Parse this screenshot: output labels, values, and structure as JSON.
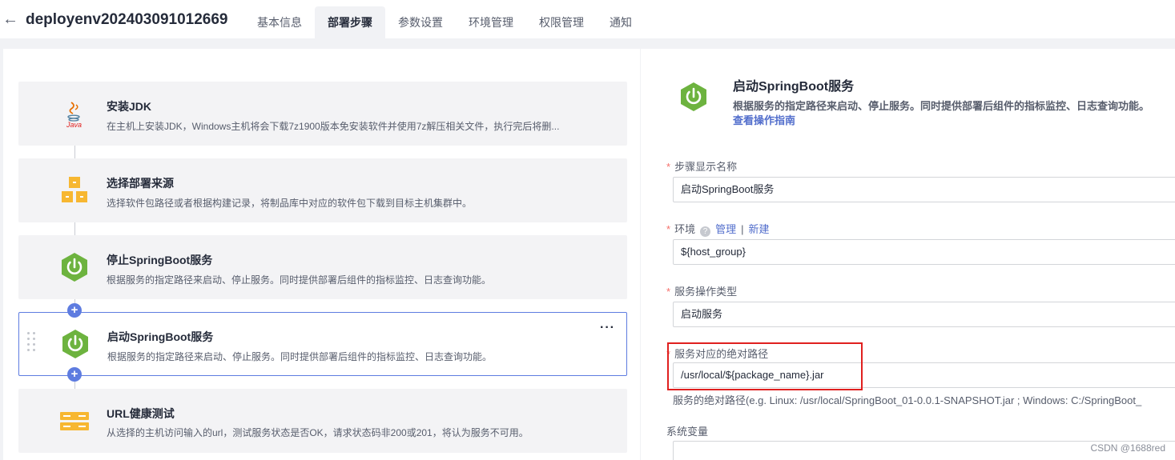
{
  "header": {
    "back_icon": "arrow-left-icon",
    "title": "deployenv202403091012669",
    "tabs": [
      {
        "label": "基本信息"
      },
      {
        "label": "部署步骤",
        "active": true
      },
      {
        "label": "参数设置"
      },
      {
        "label": "环境管理"
      },
      {
        "label": "权限管理"
      },
      {
        "label": "通知"
      }
    ]
  },
  "steps": [
    {
      "title": "安装JDK",
      "desc": "在主机上安装JDK，Windows主机将会下载7z1900版本免安装软件并使用7z解压相关文件，执行完后将删...",
      "icon": "java-icon"
    },
    {
      "title": "选择部署来源",
      "desc": "选择软件包路径或者根据构建记录，将制品库中对应的软件包下载到目标主机集群中。",
      "icon": "package-boxes-icon"
    },
    {
      "title": "停止SpringBoot服务",
      "desc": "根据服务的指定路径来启动、停止服务。同时提供部署后组件的指标监控、日志查询功能。",
      "icon": "springboot-power-icon"
    },
    {
      "title": "启动SpringBoot服务",
      "desc": "根据服务的指定路径来启动、停止服务。同时提供部署后组件的指标监控、日志查询功能。",
      "icon": "springboot-power-icon",
      "selected": true,
      "more": "···"
    },
    {
      "title": "URL健康测试",
      "desc": "从选择的主机访问输入的url，测试服务状态是否OK，请求状态码非200或201，将认为服务不可用。",
      "icon": "server-health-icon"
    }
  ],
  "add_step_symbol": "+",
  "detail": {
    "title": "启动SpringBoot服务",
    "desc": "根据服务的指定路径来启动、停止服务。同时提供部署后组件的指标监控、日志查询功能。",
    "guide_link": "查看操作指南",
    "fields": {
      "display_name": {
        "label": "步骤显示名称",
        "value": "启动SpringBoot服务"
      },
      "environment": {
        "label": "环境",
        "help": "?",
        "manage": "管理",
        "separator": "|",
        "create": "新建",
        "value": "${host_group}"
      },
      "operation_type": {
        "label": "服务操作类型",
        "value": "启动服务"
      },
      "abs_path": {
        "label": "服务对应的绝对路径",
        "value": "/usr/local/${package_name}.jar",
        "hint": "服务的绝对路径(e.g. Linux: /usr/local/SpringBoot_01-0.0.1-SNAPSHOT.jar ; Windows: C:/SpringBoot_"
      },
      "env_vars": {
        "label": "系统变量",
        "value": ""
      }
    },
    "required_mark": "*"
  },
  "watermark": "CSDN @1688red",
  "colors": {
    "accent": "#5e7ce0",
    "spring_green": "#6db33f",
    "highlight": "#e0201f",
    "package_orange": "#f7b731"
  }
}
